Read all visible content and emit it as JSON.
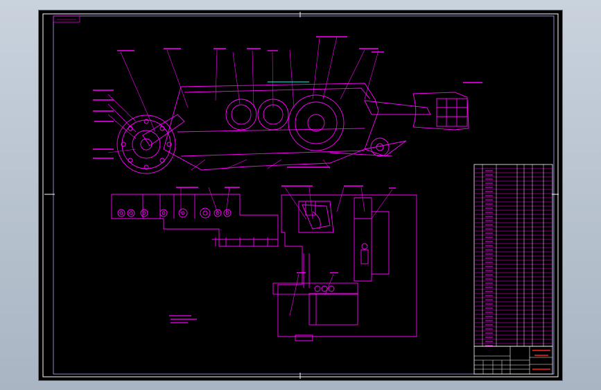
{
  "viewport": {
    "background": "#b7c1ce"
  },
  "sheet": {
    "background": "#000000",
    "frame_color": "#ffffff",
    "line_color": "#ff00ff",
    "accent_color": "#00ffff",
    "title_block": {
      "name_text": "",
      "drawing_no": ""
    }
  }
}
